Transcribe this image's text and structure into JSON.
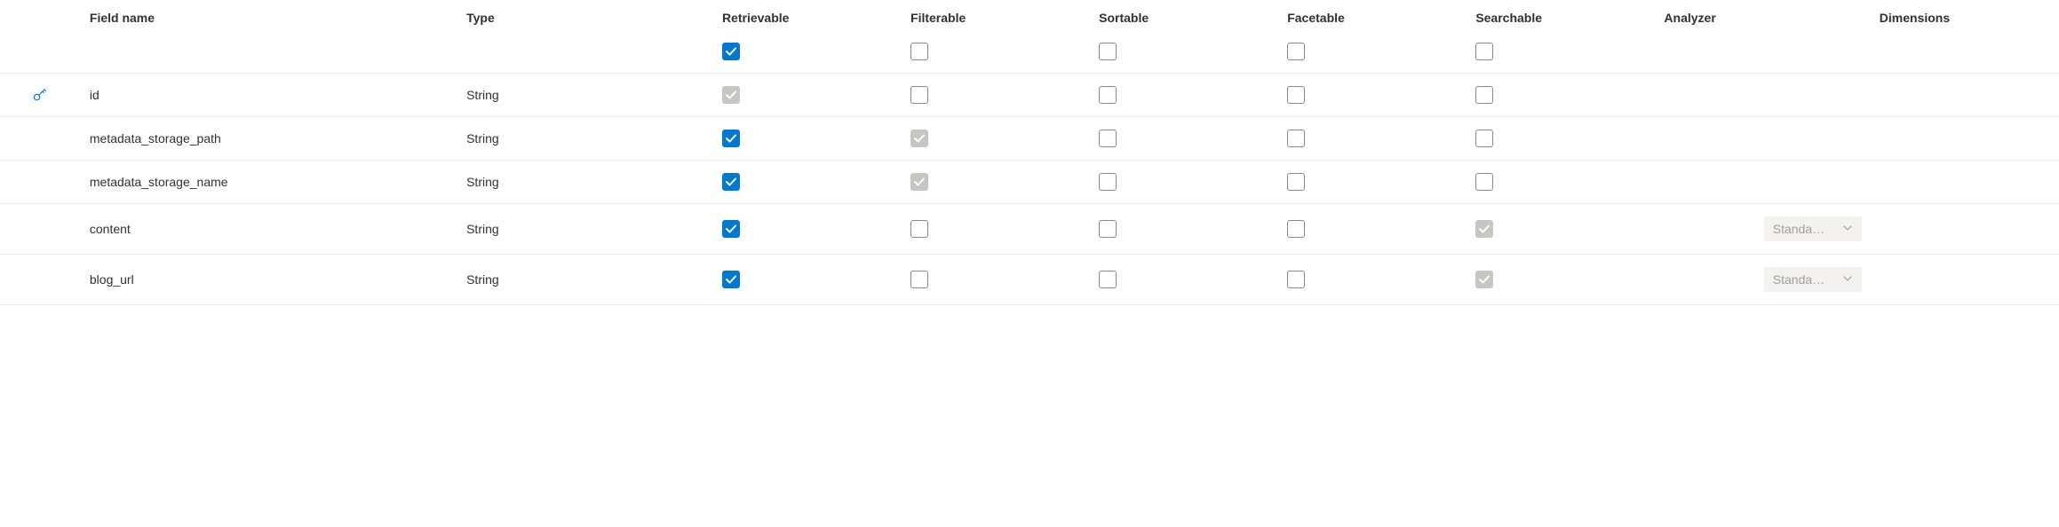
{
  "columns": {
    "field_name": "Field name",
    "type": "Type",
    "retrievable": "Retrievable",
    "filterable": "Filterable",
    "sortable": "Sortable",
    "facetable": "Facetable",
    "searchable": "Searchable",
    "analyzer": "Analyzer",
    "dimensions": "Dimensions"
  },
  "header_checks": {
    "retrievable": {
      "state": "checked"
    },
    "filterable": {
      "state": "unchecked"
    },
    "sortable": {
      "state": "unchecked"
    },
    "facetable": {
      "state": "unchecked"
    },
    "searchable": {
      "state": "unchecked"
    }
  },
  "analyzer_label": "Standa…",
  "rows": [
    {
      "is_key": true,
      "field_name": "id",
      "type": "String",
      "retrievable": "checked-disabled",
      "filterable": "unchecked",
      "sortable": "unchecked",
      "facetable": "unchecked",
      "searchable": "unchecked",
      "analyzer": null
    },
    {
      "is_key": false,
      "field_name": "metadata_storage_path",
      "type": "String",
      "retrievable": "checked",
      "filterable": "checked-disabled",
      "sortable": "unchecked",
      "facetable": "unchecked",
      "searchable": "unchecked",
      "analyzer": null
    },
    {
      "is_key": false,
      "field_name": "metadata_storage_name",
      "type": "String",
      "retrievable": "checked",
      "filterable": "checked-disabled",
      "sortable": "unchecked",
      "facetable": "unchecked",
      "searchable": "unchecked",
      "analyzer": null
    },
    {
      "is_key": false,
      "field_name": "content",
      "type": "String",
      "retrievable": "checked",
      "filterable": "unchecked",
      "sortable": "unchecked",
      "facetable": "unchecked",
      "searchable": "checked-disabled",
      "analyzer": "Standa…"
    },
    {
      "is_key": false,
      "field_name": "blog_url",
      "type": "String",
      "retrievable": "checked",
      "filterable": "unchecked",
      "sortable": "unchecked",
      "facetable": "unchecked",
      "searchable": "checked-disabled",
      "analyzer": "Standa…"
    }
  ]
}
